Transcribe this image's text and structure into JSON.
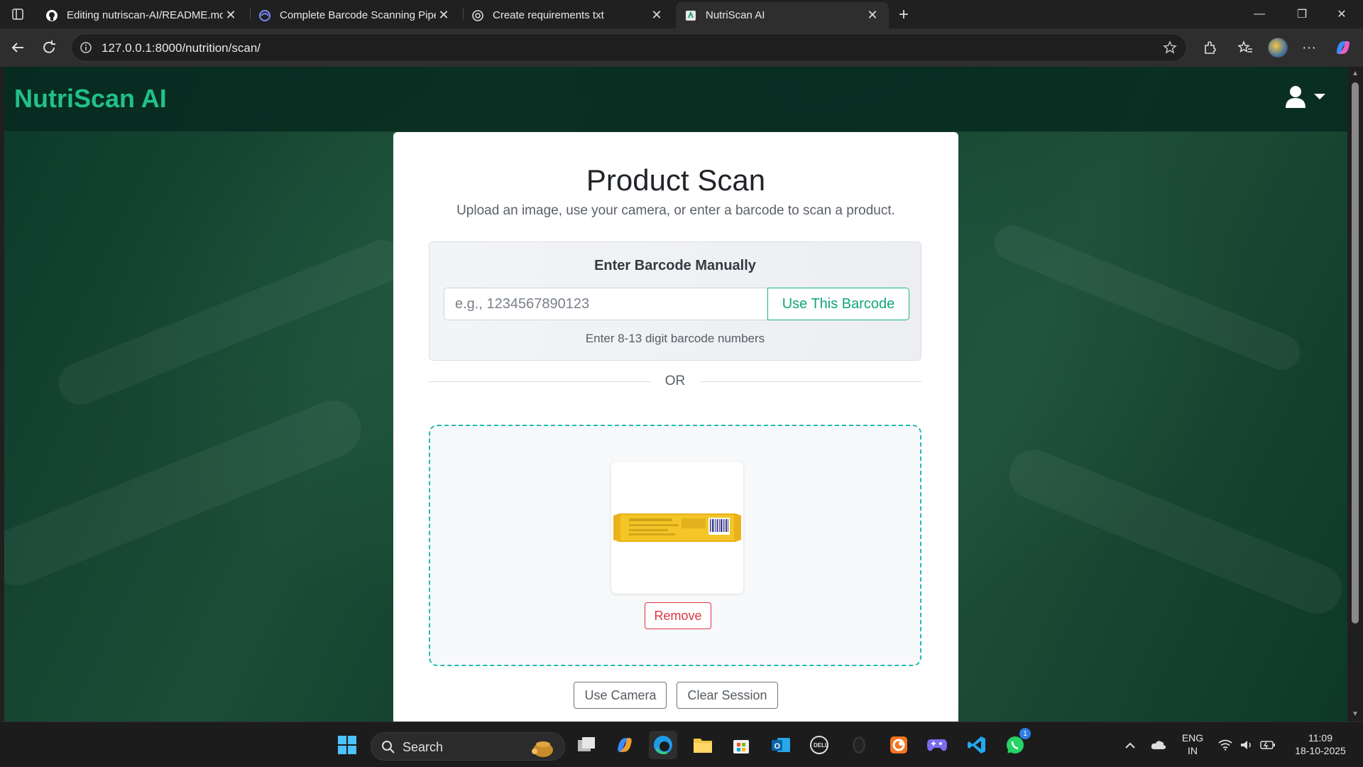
{
  "browser": {
    "tabs": [
      {
        "title": "Editing nutriscan-AI/README.md",
        "active": false
      },
      {
        "title": "Complete Barcode Scanning Pipeline",
        "active": false
      },
      {
        "title": "Create requirements txt",
        "active": false
      },
      {
        "title": "NutriScan AI",
        "active": true
      }
    ],
    "url": "127.0.0.1:8000/nutrition/scan/"
  },
  "page": {
    "brand": "NutriScan AI",
    "title": "Product Scan",
    "subtitle": "Upload an image, use your camera, or enter a barcode to scan a product.",
    "manual": {
      "heading": "Enter Barcode Manually",
      "placeholder": "e.g., 1234567890123",
      "value": "",
      "button": "Use This Barcode",
      "hint": "Enter 8-13 digit barcode numbers"
    },
    "divider": "OR",
    "upload": {
      "preview_alt": "Uploaded product image",
      "remove_button": "Remove"
    },
    "actions": {
      "camera": "Use Camera",
      "clear": "Clear Session"
    }
  },
  "taskbar": {
    "search": "Search",
    "lang": "ENG",
    "region": "IN",
    "time": "11:09",
    "date": "18-10-2025",
    "whatsapp_badge": "1"
  },
  "colors": {
    "brand": "#22c08a",
    "accent": "#12a57c",
    "danger": "#dc3545",
    "dropzone_border": "#22bdb0"
  }
}
